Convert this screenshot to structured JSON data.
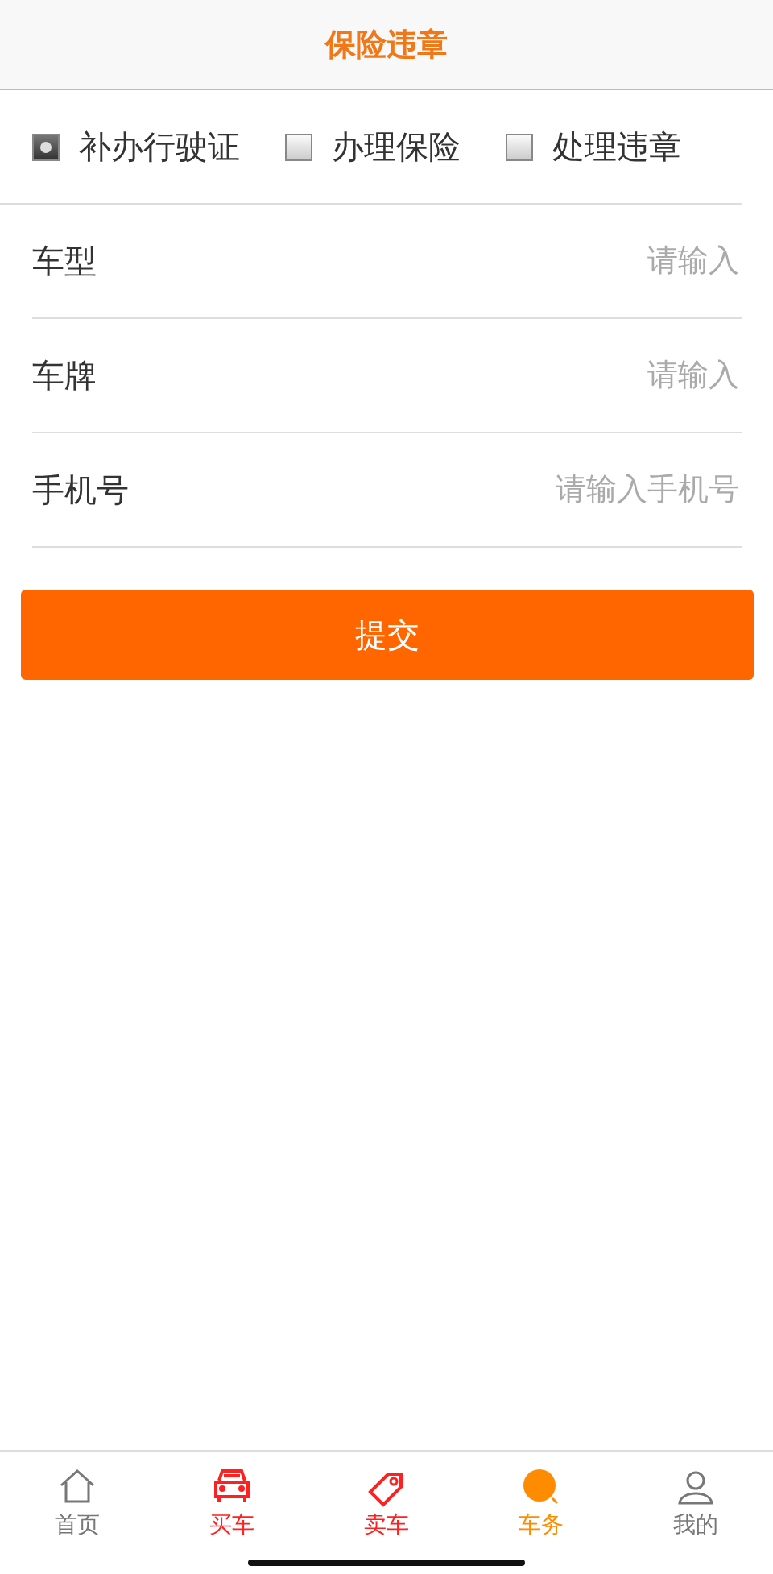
{
  "header": {
    "title": "保险违章"
  },
  "options": [
    {
      "label": "补办行驶证",
      "checked": true
    },
    {
      "label": "办理保险",
      "checked": false
    },
    {
      "label": "处理违章",
      "checked": false
    }
  ],
  "fields": [
    {
      "label": "车型",
      "placeholder": "请输入"
    },
    {
      "label": "车牌",
      "placeholder": "请输入"
    },
    {
      "label": "手机号",
      "placeholder": "请输入手机号"
    }
  ],
  "submit": "提交",
  "tabs": [
    {
      "kind": "home",
      "label": "首页",
      "color": "#777777"
    },
    {
      "kind": "car",
      "label": "买车",
      "color": "#ff2020"
    },
    {
      "kind": "tag",
      "label": "卖车",
      "color": "#ff2020"
    },
    {
      "kind": "service",
      "label": "车务",
      "color": "#ff8c00"
    },
    {
      "kind": "user",
      "label": "我的",
      "color": "#777777"
    }
  ]
}
